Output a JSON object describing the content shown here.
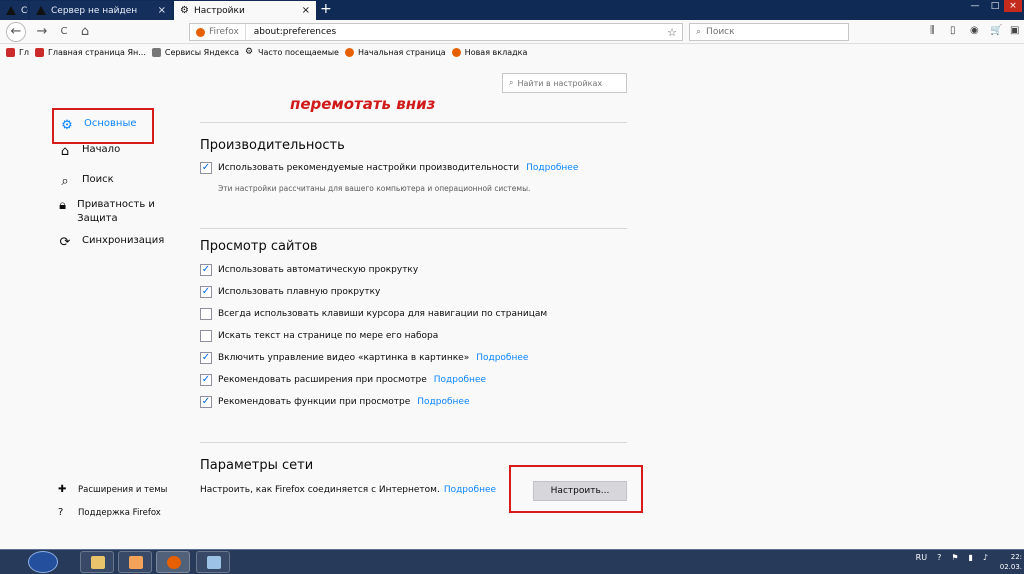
{
  "tabs": [
    {
      "label": "Се",
      "active": false
    },
    {
      "label": "Сервер не найден",
      "active": false
    },
    {
      "label": "Настройки",
      "active": true
    }
  ],
  "tab_close_glyph": "×",
  "new_tab_glyph": "+",
  "window": {
    "minimize": "—",
    "maximize": "□",
    "close": "×"
  },
  "nav": {
    "back_glyph": "←",
    "forward_glyph": "→",
    "reload_glyph": "C",
    "home_glyph": "⌂",
    "url_identity": "Firefox",
    "url": "about:preferences",
    "search_placeholder": "Поиск",
    "star_glyph": "☆"
  },
  "toolbar_icons": [
    "library-icon",
    "sidebar-icon",
    "account-icon",
    "cart-icon",
    "extension-icon"
  ],
  "bookmarks": [
    {
      "label": "Гл",
      "icon": "yandex-icon",
      "color": "#cc2b2b"
    },
    {
      "label": "Главная страница Ян...",
      "icon": "yandex-icon",
      "color": "#cc2b2b"
    },
    {
      "label": "Сервисы Яндекса",
      "icon": "folder-icon",
      "color": "#777777"
    },
    {
      "label": "Часто посещаемые",
      "icon": "gear-icon",
      "color": "#555555"
    },
    {
      "label": "Начальная страница",
      "icon": "firefox-icon",
      "color": "#e66000"
    },
    {
      "label": "Новая вкладка",
      "icon": "firefox-icon",
      "color": "#e66000"
    }
  ],
  "find_placeholder": "Найти в настройках",
  "annotation": "перемотать вниз",
  "sidebar": {
    "general": "Основные",
    "home": "Начало",
    "search": "Поиск",
    "privacy": "Приватность и Защита",
    "sync": "Синхронизация",
    "extensions": "Расширения и темы",
    "support": "Поддержка Firefox"
  },
  "performance": {
    "title": "Производительность",
    "recommended": "Использовать рекомендуемые настройки производительности",
    "more": "Подробнее",
    "note": "Эти настройки рассчитаны для вашего компьютера и операционной системы."
  },
  "browsing": {
    "title": "Просмотр сайтов",
    "options": [
      {
        "label": "Использовать автоматическую прокрутку",
        "checked": true,
        "more": ""
      },
      {
        "label": "Использовать плавную прокрутку",
        "checked": true,
        "more": ""
      },
      {
        "label": "Всегда использовать клавиши курсора для навигации по страницам",
        "checked": false,
        "more": ""
      },
      {
        "label": "Искать текст на странице по мере его набора",
        "checked": false,
        "more": ""
      },
      {
        "label": "Включить управление видео «картинка в картинке»",
        "checked": true,
        "more": "Подробнее"
      },
      {
        "label": "Рекомендовать расширения при просмотре",
        "checked": true,
        "more": "Подробнее"
      },
      {
        "label": "Рекомендовать функции при просмотре",
        "checked": true,
        "more": "Подробнее"
      }
    ]
  },
  "network": {
    "title": "Параметры сети",
    "description": "Настроить, как Firefox соединяется с Интернетом.",
    "more": "Подробнее",
    "button": "Настроить..."
  },
  "checkmark": "✓",
  "taskbar": {
    "lang": "RU",
    "time": "22:",
    "date": "02.03."
  },
  "colors": {
    "accent": "#0a84ff",
    "highlight_frame": "#d81b1b",
    "tabstrip": "#0f2b55"
  }
}
